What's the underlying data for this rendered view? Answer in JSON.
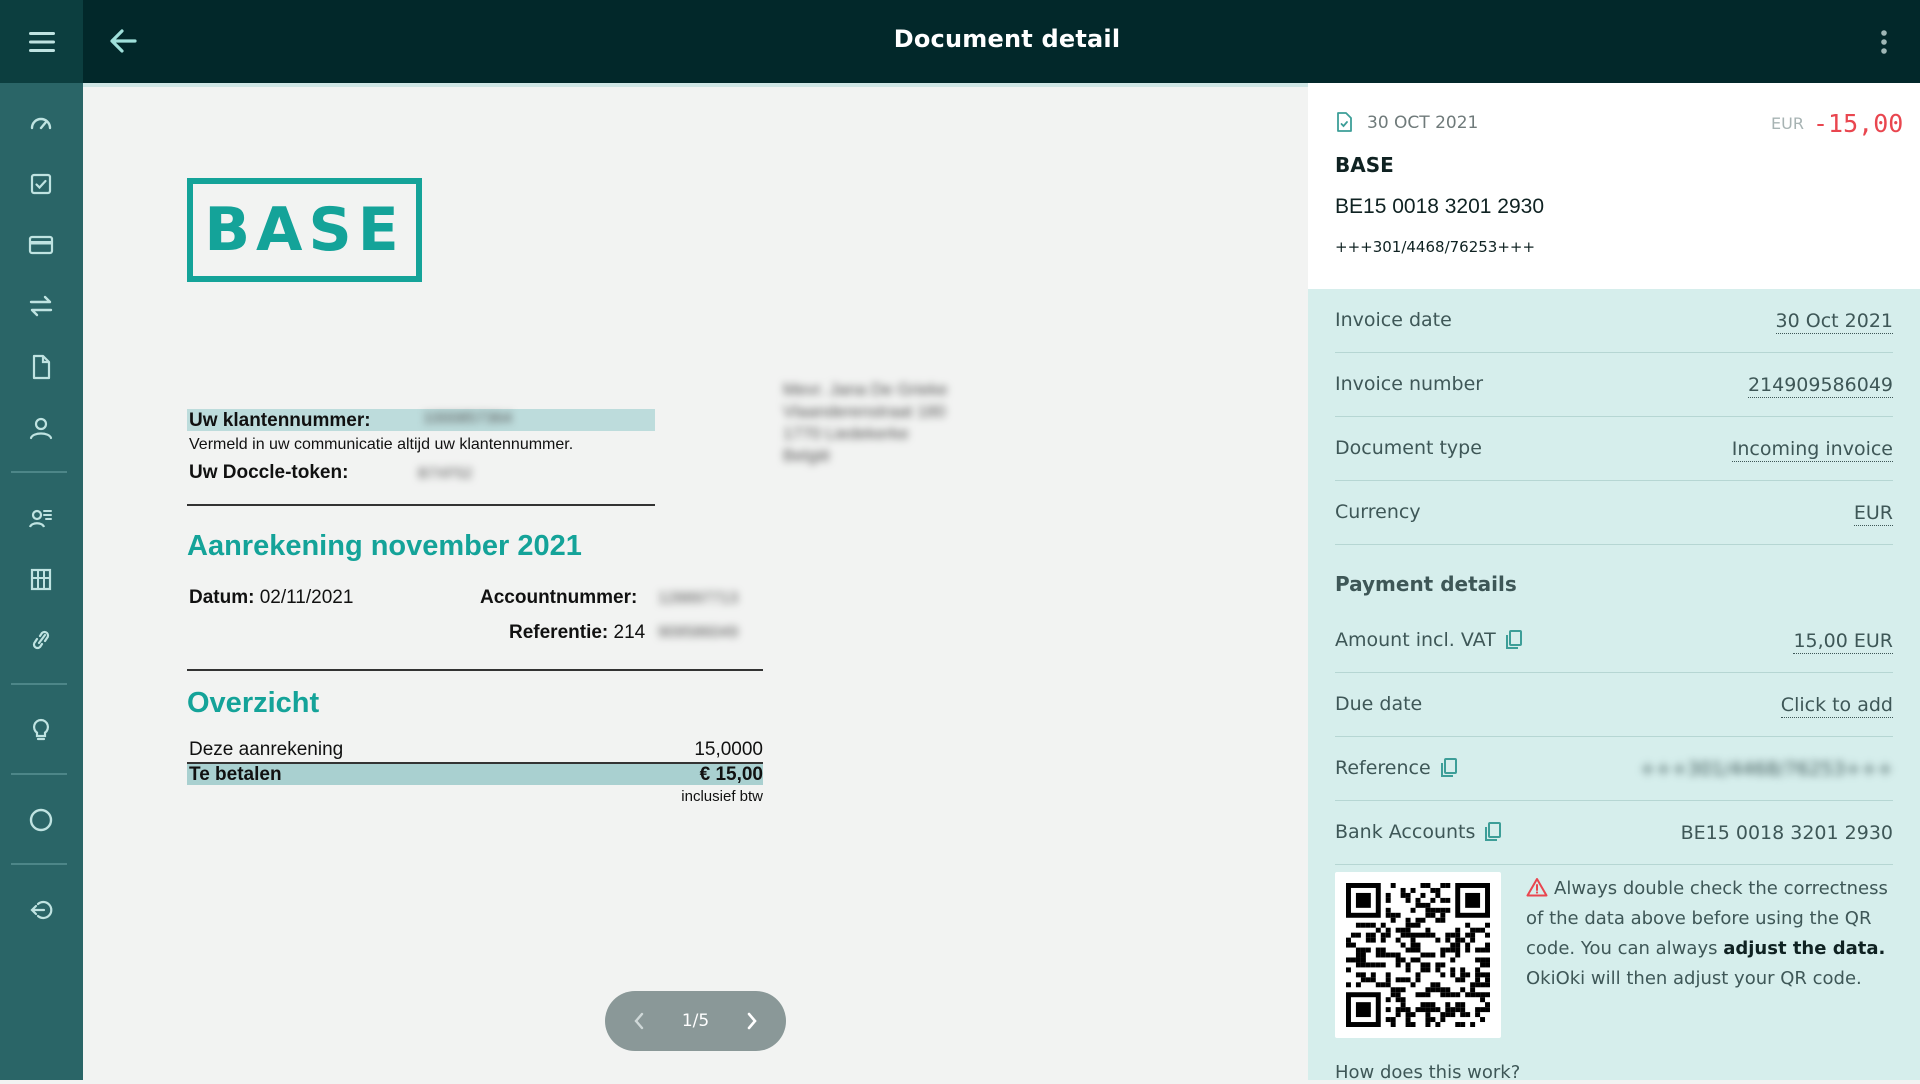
{
  "topbar": {
    "title": "Document detail",
    "menu_icon": "hamburger-menu-icon",
    "back_icon": "arrow-left-icon",
    "more_icon": "more-vertical-icon"
  },
  "sidebar": {
    "items": [
      {
        "icon": "dashboard-icon"
      },
      {
        "icon": "checkbox-icon"
      },
      {
        "icon": "credit-card-icon"
      },
      {
        "icon": "transfer-icon"
      },
      {
        "icon": "document-icon"
      },
      {
        "icon": "contacts-icon"
      },
      {
        "icon": "user-list-icon"
      },
      {
        "icon": "building-icon"
      },
      {
        "icon": "link-icon"
      },
      {
        "icon": "lightbulb-icon"
      },
      {
        "icon": "circle-icon"
      },
      {
        "icon": "logout-icon"
      }
    ]
  },
  "document": {
    "logo_text": "BASE",
    "klant_label": "Uw klantennummer:",
    "klant_value": "1000857364",
    "vermeld": "Vermeld in uw communicatie altijd uw klantennummer.",
    "doccle_label": "Uw Doccle-token:",
    "doccle_value": "B7XF52",
    "address": [
      "Mevr. Jana De Grieke",
      "Vlaanderenstraat 180",
      "1770 Liedekerke",
      "België"
    ],
    "heading_invoice": "Aanrekening november 2021",
    "datum_label": "Datum:",
    "datum_value": "02/11/2021",
    "account_label": "Accountnummer:",
    "account_value": "128897713",
    "referentie_label": "Referentie:",
    "referentie_value": "214",
    "referentie_hidden": "909586049",
    "heading_overview": "Overzicht",
    "deze_label": "Deze aanrekening",
    "deze_value": "15,0000",
    "te_betalen_label": "Te betalen",
    "te_betalen_value": "€ 15,00",
    "btw_note": "inclusief btw"
  },
  "pager": {
    "label": "1/5",
    "prev_icon": "chevron-left-icon",
    "next_icon": "chevron-right-icon"
  },
  "panel": {
    "date": "30 OCT 2021",
    "currency": "EUR",
    "amount": "-15,00",
    "name": "BASE",
    "iban": "BE15 0018 3201 2930",
    "ogm": "+++301/4468/76253+++",
    "fields": [
      {
        "label": "Invoice date",
        "value": "30 Oct 2021"
      },
      {
        "label": "Invoice number",
        "value": "214909586049"
      },
      {
        "label": "Document type",
        "value": "Incoming invoice"
      },
      {
        "label": "Currency",
        "value": "EUR"
      }
    ],
    "payment_title": "Payment details",
    "payment_fields": [
      {
        "label": "Amount incl. VAT",
        "value": "15,00 EUR"
      },
      {
        "label": "Due date",
        "value": "Click to add"
      },
      {
        "label": "Reference",
        "value": "+++301/4468/76253+++"
      },
      {
        "label": "Bank Accounts",
        "value": "BE15 0018 3201 2930"
      }
    ],
    "warning_text_1": "Always double check the correctness of the data above before using the QR code. You can always",
    "warning_bold": "adjust the data.",
    "warning_text_2": "OkiOki will then adjust your QR code.",
    "howto": "How does this work?",
    "colors": {
      "accent": "#14a399",
      "negative": "#e9464f",
      "header": "#02282a",
      "sidebar": "#2a6567"
    }
  }
}
